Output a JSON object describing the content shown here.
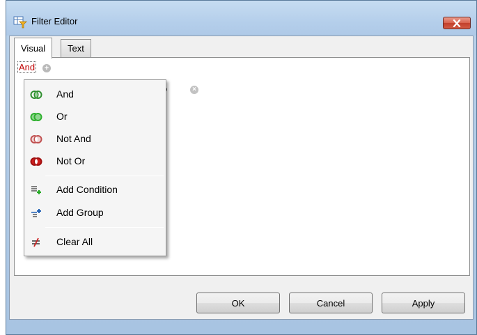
{
  "window": {
    "title": "Filter Editor",
    "icon": "filter-editor-icon",
    "close_icon": "close-icon"
  },
  "tabs": [
    {
      "label": "Visual",
      "active": true
    },
    {
      "label": "Text",
      "active": false
    }
  ],
  "filter": {
    "root_group_label": "And",
    "add_icon": "add-circle-icon",
    "partial_condition_text": "D",
    "remove_icon": "remove-circle-icon"
  },
  "context_menu": {
    "items": [
      {
        "label": "And",
        "icon": "and-group-icon",
        "color": "#2f8f2f"
      },
      {
        "label": "Or",
        "icon": "or-group-icon",
        "color": "#2fb02f"
      },
      {
        "label": "Not And",
        "icon": "not-and-group-icon",
        "color": "#c05050"
      },
      {
        "label": "Not Or",
        "icon": "not-or-group-icon",
        "color": "#d02020"
      },
      {
        "label": "Add Condition",
        "icon": "add-condition-icon"
      },
      {
        "label": "Add Group",
        "icon": "add-group-icon"
      },
      {
        "label": "Clear All",
        "icon": "clear-all-icon"
      }
    ]
  },
  "buttons": {
    "ok": "OK",
    "cancel": "Cancel",
    "apply": "Apply"
  }
}
